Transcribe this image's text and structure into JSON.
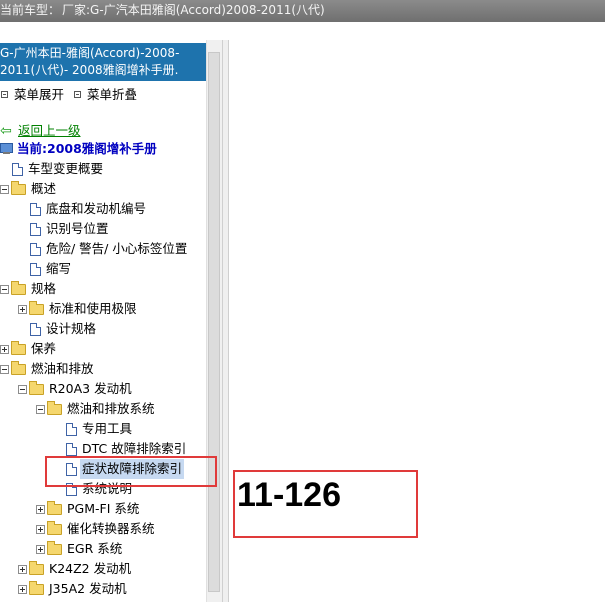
{
  "title_bar": {
    "label": "当前车型：",
    "value": "厂家:G-广汽本田雅阁(Accord)2008-2011(八代)"
  },
  "sidebar": {
    "header_lines": [
      "G-广州本田-雅阁(Accord)-2008-",
      "2011(八代)- 2008雅阁增补手册."
    ],
    "menu": {
      "expand": "菜单展开",
      "collapse": "菜单折叠"
    },
    "back_link": "返回上一级",
    "current": "当前:2008雅阁增补手册",
    "tree": [
      {
        "label": "车型变更概要",
        "type": "doc"
      },
      {
        "label": "概述",
        "type": "folder"
      },
      {
        "label": "底盘和发动机编号",
        "type": "doc"
      },
      {
        "label": "识别号位置",
        "type": "doc"
      },
      {
        "label": "危险/ 警告/ 小心标签位置",
        "type": "doc"
      },
      {
        "label": "缩写",
        "type": "doc"
      },
      {
        "label": "规格",
        "type": "folder"
      },
      {
        "label": "标准和使用极限",
        "type": "folder"
      },
      {
        "label": "设计规格",
        "type": "doc"
      },
      {
        "label": "保养",
        "type": "folder"
      },
      {
        "label": "燃油和排放",
        "type": "folder"
      },
      {
        "label": "R20A3 发动机",
        "type": "folder"
      },
      {
        "label": "燃油和排放系统",
        "type": "folder"
      },
      {
        "label": "专用工具",
        "type": "doc"
      },
      {
        "label": "DTC 故障排除索引",
        "type": "doc"
      },
      {
        "label": "症状故障排除索引",
        "type": "doc"
      },
      {
        "label": "系统说明",
        "type": "doc"
      },
      {
        "label": "PGM-FI 系统",
        "type": "folder"
      },
      {
        "label": "催化转换器系统",
        "type": "folder"
      },
      {
        "label": "EGR 系统",
        "type": "folder"
      },
      {
        "label": "K24Z2 发动机",
        "type": "folder"
      },
      {
        "label": "J35A2 发动机",
        "type": "folder"
      }
    ]
  },
  "content": {
    "page_number": "11-126"
  },
  "colors": {
    "header_bg": "#1e73ad",
    "highlight_box": "#e03a3a",
    "link": "#008000",
    "current": "#0000c0"
  }
}
